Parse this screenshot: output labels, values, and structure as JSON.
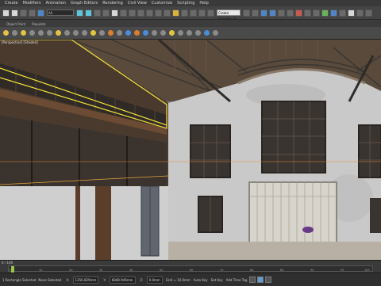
{
  "menu": {
    "items": [
      "Create",
      "Modifiers",
      "Animation",
      "Graph Editors",
      "Rendering",
      "Civil View",
      "Customize",
      "Scripting",
      "Help"
    ]
  },
  "toolbar": {
    "selection_filter": "All",
    "named_selection": "Create Selection Se"
  },
  "ribbon": {
    "labels": [
      "Object Paint",
      "Populate"
    ]
  },
  "viewport": {
    "label": "[Perspective] [Shaded]"
  },
  "timeline": {
    "frame_counter": "0 / 100",
    "ticks": [
      "0",
      "10",
      "20",
      "30",
      "40",
      "50",
      "60",
      "70",
      "80",
      "85",
      "90",
      "95",
      "100"
    ]
  },
  "status": {
    "selected": "1 Rectangle Selected",
    "prompt": "None Selected",
    "x_label": "X:",
    "x_value": "1356.829mm",
    "y_label": "Y:",
    "y_value": "6848.946mm",
    "z_label": "Z:",
    "z_value": "0.0mm",
    "grid": "Grid = 10.0mm",
    "auto_key": "Auto Key",
    "add_time_tag": "Add Time Tag",
    "set_key": "Set Key"
  }
}
